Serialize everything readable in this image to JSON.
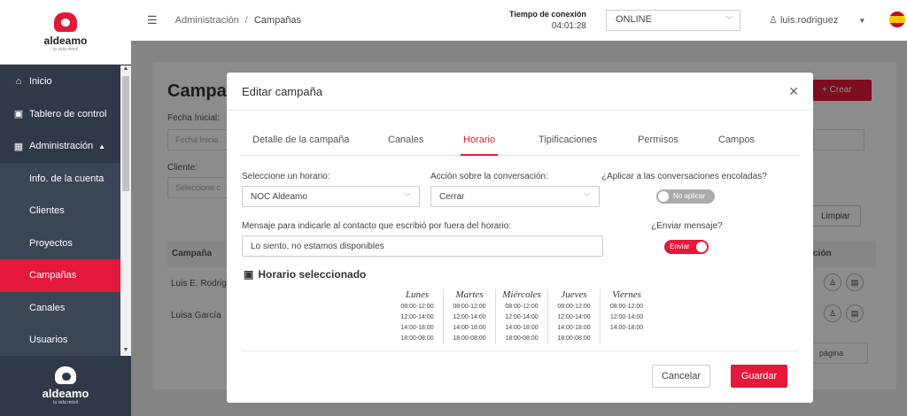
{
  "brand": {
    "name": "aldeamo",
    "tagline": "tu vida móvil"
  },
  "sidebar": {
    "items": [
      {
        "label": "Inicio",
        "icon": "home-icon"
      },
      {
        "label": "Tablero de control",
        "icon": "dashboard-icon"
      },
      {
        "label": "Administración",
        "icon": "admin-icon",
        "expanded": true
      }
    ],
    "sub_items": [
      {
        "label": "Info. de la cuenta"
      },
      {
        "label": "Clientes"
      },
      {
        "label": "Proyectos"
      },
      {
        "label": "Campañas",
        "active": true
      },
      {
        "label": "Canales"
      },
      {
        "label": "Usuarios"
      }
    ]
  },
  "header": {
    "breadcrumb": [
      "Administración",
      "Campañas"
    ],
    "connection_label": "Tiempo de conexión",
    "connection_time": "04:01:28",
    "status": "ONLINE",
    "user": "luis.rodriguez"
  },
  "background_page": {
    "title": "Campa",
    "fecha_inicial_label": "Fecha Inicial:",
    "fecha_inicial_placeholder": "Fecha Inicia",
    "cliente_label": "Cliente:",
    "cliente_placeholder": "Seleccione c",
    "crear_button": "+ Crear",
    "limpiar_button": "Limpiar",
    "table_headers": [
      "Campaña",
      "ción"
    ],
    "rows": [
      "Luis E. Rodrig",
      "Luisa García"
    ],
    "pagination": "página"
  },
  "modal": {
    "title": "Editar campaña",
    "tabs": [
      "Detalle de la campaña",
      "Canales",
      "Horario",
      "Tipificaciones",
      "Permisos",
      "Campos"
    ],
    "active_tab": "Horario",
    "horario_label": "Seleccione un horario:",
    "horario_value": "NOC Aldeamo",
    "accion_label": "Acción sobre la conversación:",
    "accion_value": "Cerrar",
    "aplicar_label": "¿Aplicar a las conversaciones encoladas?",
    "aplicar_toggle": "No aplicar",
    "mensaje_label": "Mensaje para indicarle al contacto que escribió por fuera del horario:",
    "mensaje_value": "Lo siento, no estamos disponibles",
    "enviar_label": "¿Enviar mensaje?",
    "enviar_toggle": "Enviar",
    "schedule_title": "Horario seleccionado",
    "schedule": [
      {
        "day": "Lunes",
        "slots": [
          "08:00-12:00",
          "12:00-14:00",
          "14:00-18:00",
          "18:00-08:00"
        ]
      },
      {
        "day": "Martes",
        "slots": [
          "08:00-12:00",
          "12:00-14:00",
          "14:00-18:00",
          "18:00-08:00"
        ]
      },
      {
        "day": "Miércoles",
        "slots": [
          "08:00-12:00",
          "12:00-14:00",
          "14:00-18:00",
          "18:00-08:00"
        ]
      },
      {
        "day": "Jueves",
        "slots": [
          "08:00-12:00",
          "12:00-14:00",
          "14:00-18:00",
          "18:00-08:00"
        ]
      },
      {
        "day": "Viernes",
        "slots": [
          "08:00-12:00",
          "12:00-14:00",
          "14:00-18:00"
        ]
      }
    ],
    "cancel_button": "Cancelar",
    "save_button": "Guardar"
  },
  "colors": {
    "accent": "#e4183a",
    "sidebar": "#2f3947"
  }
}
